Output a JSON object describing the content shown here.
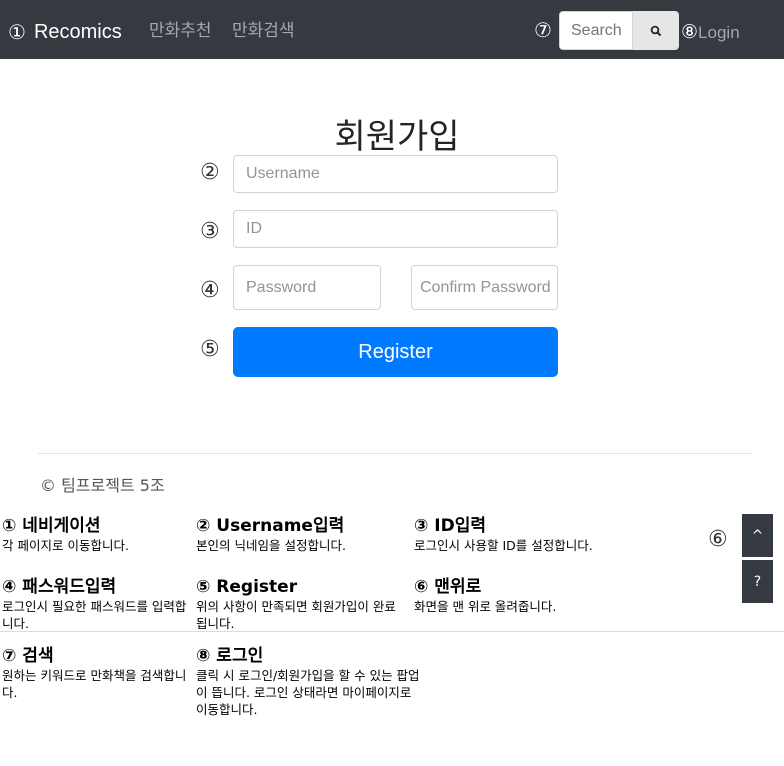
{
  "navbar": {
    "brand_num": "①",
    "brand": "Recomics",
    "links": [
      "만화추천",
      "만화검색"
    ],
    "search_num": "⑦",
    "search_placeholder": "Search",
    "login_num": "⑧",
    "login_label": "Login",
    "bg_color": "#343a40"
  },
  "form": {
    "title": "회원가입",
    "marks": [
      "②",
      "③",
      "④",
      "⑤"
    ],
    "username_placeholder": "Username",
    "id_placeholder": "ID",
    "password_placeholder": "Password",
    "confirm_placeholder": "Confirm Password",
    "register_label": "Register",
    "accent_color": "#007bff"
  },
  "footer": {
    "copyright": "© 팀프로젝트 5조"
  },
  "side": {
    "num": "⑥",
    "top_label": "^",
    "help_label": "?"
  },
  "legend": [
    {
      "title": "① 네비게이션",
      "desc": "각 페이지로 이동합니다."
    },
    {
      "title": "② Username입력",
      "desc": "본인의 닉네임을 설정합니다."
    },
    {
      "title": "③ ID입력",
      "desc": "로그인시 사용할 ID를 설정합니다."
    },
    {
      "title": "④ 패스워드입력",
      "desc": "로그인시 필요한 패스워드를 입력합니다."
    },
    {
      "title": "⑤ Register",
      "desc": "위의 사항이 만족되면 회원가입이 완료됩니다."
    },
    {
      "title": "⑥ 맨위로",
      "desc": "화면을 맨 위로 올려줍니다."
    },
    {
      "title": "⑦ 검색",
      "desc": "원하는 키워드로 만화책을 검색합니다."
    },
    {
      "title": "⑧ 로그인",
      "desc": "클릭 시 로그인/회원가입을 할 수 있는 팝업이 뜹니다. 로그인 상태라면 마이페이지로 이동합니다."
    }
  ]
}
